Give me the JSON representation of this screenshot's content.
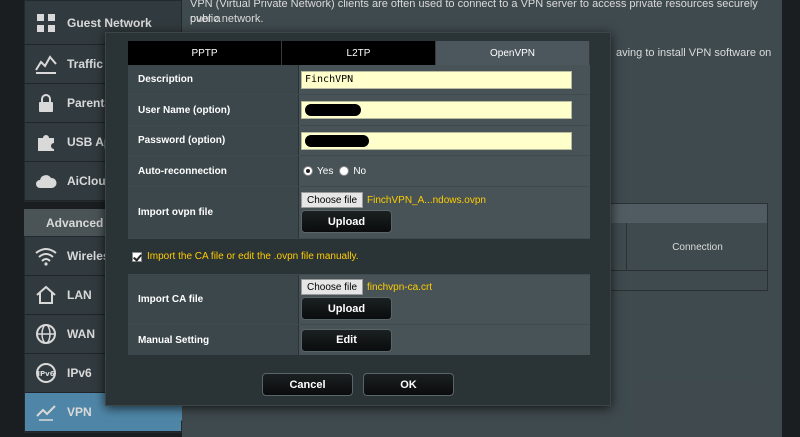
{
  "sidebar": {
    "top_items": [
      {
        "label": "Guest Network",
        "icon": "guest-network-icon"
      },
      {
        "label": "Traffic M",
        "icon": "traffic-manager-icon"
      },
      {
        "label": "Parenta",
        "icon": "lock-icon"
      },
      {
        "label": "USB App",
        "icon": "puzzle-icon"
      },
      {
        "label": "AiCloud",
        "icon": "cloud-icon"
      }
    ],
    "advanced_label": "Advanced",
    "advanced_items": [
      {
        "label": "Wireles",
        "icon": "wifi-icon"
      },
      {
        "label": "LAN",
        "icon": "home-icon"
      },
      {
        "label": "WAN",
        "icon": "globe-icon"
      },
      {
        "label": "IPv6",
        "icon": "ipv6-icon"
      },
      {
        "label": "VPN",
        "icon": "vpn-icon"
      }
    ]
  },
  "background": {
    "intro_line1": "VPN (Virtual Private Network) clients are often used to connect to a VPN server to access private resources securely over a",
    "intro_line2": "public network.",
    "intro_partial": "aving to install VPN software on",
    "table_header": "Connection"
  },
  "modal": {
    "tabs": [
      {
        "label": "PPTP",
        "active": false
      },
      {
        "label": "L2TP",
        "active": false
      },
      {
        "label": "OpenVPN",
        "active": true
      }
    ],
    "description_label": "Description",
    "description_value": "FinchVPN",
    "username_label": "User Name (option)",
    "password_label": "Password (option)",
    "auto_reconnect_label": "Auto-reconnection",
    "auto_reconnect_yes": "Yes",
    "auto_reconnect_no": "No",
    "import_ovpn_label": "Import ovpn file",
    "choose_file_label": "Choose file",
    "ovpn_filename": "FinchVPN_A...ndows.ovpn",
    "upload_label": "Upload",
    "ca_checkbox_label": "Import the CA file or edit the .ovpn file manually.",
    "import_ca_label": "Import CA file",
    "ca_filename": "finchvpn-ca.crt",
    "manual_setting_label": "Manual Setting",
    "edit_label": "Edit",
    "cancel_label": "Cancel",
    "ok_label": "OK"
  },
  "colors": {
    "accent": "#5d9ec5",
    "file_name": "#ffcc00",
    "input_bg": "#ffffcc"
  }
}
